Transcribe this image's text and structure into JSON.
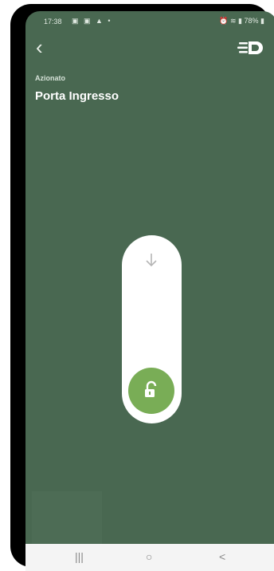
{
  "status": {
    "time": "17:38",
    "left_icons": "▣ ▣ ▲ •",
    "battery": "78%"
  },
  "header": {
    "back_icon": "chevron-left",
    "brand_icon": "brand-logo"
  },
  "device": {
    "state_label": "Azionato",
    "name": "Porta Ingresso"
  },
  "slider": {
    "icon_top": "arrow-down",
    "knob_icon": "unlock",
    "knob_color": "#79ad56",
    "position": 1.0
  },
  "navbar": {
    "recent": "|||",
    "home": "○",
    "back": "<"
  }
}
